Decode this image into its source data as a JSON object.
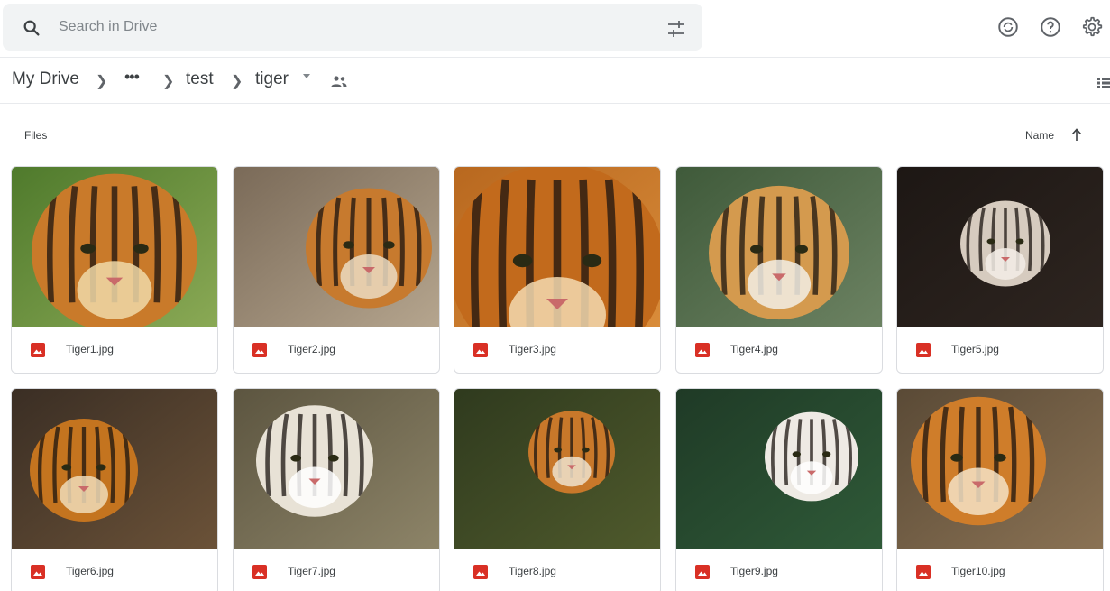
{
  "search": {
    "placeholder": "Search in Drive"
  },
  "breadcrumb": {
    "root": "My Drive",
    "more": "•••",
    "folder1": "test",
    "current": "tiger"
  },
  "section": {
    "label": "Files"
  },
  "sort": {
    "label": "Name"
  },
  "files": [
    {
      "name": "Tiger1.jpg"
    },
    {
      "name": "Tiger2.jpg"
    },
    {
      "name": "Tiger3.jpg"
    },
    {
      "name": "Tiger4.jpg"
    },
    {
      "name": "Tiger5.jpg"
    },
    {
      "name": "Tiger6.jpg"
    },
    {
      "name": "Tiger7.jpg"
    },
    {
      "name": "Tiger8.jpg"
    },
    {
      "name": "Tiger9.jpg"
    },
    {
      "name": "Tiger10.jpg"
    }
  ],
  "colors": {
    "image_icon": "#d93025",
    "border": "#dadce0",
    "text": "#3c4043"
  }
}
